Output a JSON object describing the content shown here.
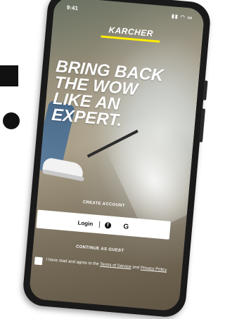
{
  "status": {
    "time": "9:41",
    "icons": "▮▮ ◠ ▭"
  },
  "brand": {
    "name": "KARCHER",
    "accent": "#ffed00"
  },
  "headline": "BRING BACK THE WOW LIKE AN EXPERT.",
  "create_account": "CREATE ACCOUNT",
  "login": {
    "label": "Login",
    "separator": "|",
    "facebook_glyph": "f",
    "apple_glyph": "",
    "google_glyph": "G"
  },
  "guest": "CONTINUE AS GUEST",
  "terms": {
    "prefix": "I have read and agree to the",
    "link1": "Terms of Service",
    "middle": "and",
    "link2": "Privacy Policy"
  }
}
